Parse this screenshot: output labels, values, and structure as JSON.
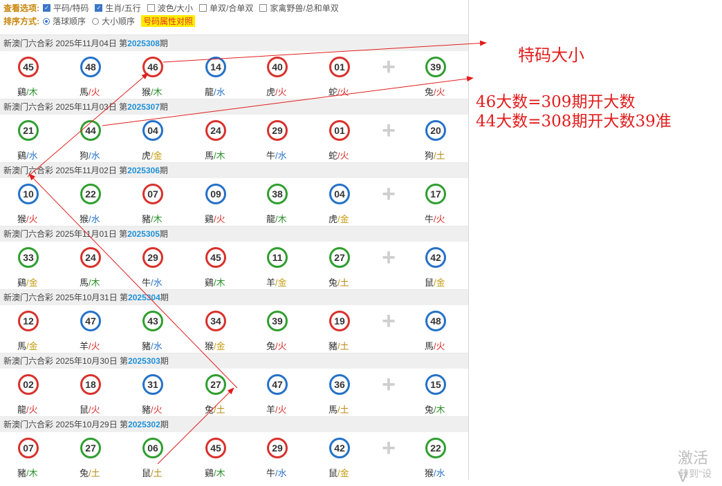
{
  "options": {
    "view_label": "查看选项:",
    "view_items": [
      {
        "label": "平码/特码",
        "checked": true
      },
      {
        "label": "生肖/五行",
        "checked": true
      },
      {
        "label": "波色/大小",
        "checked": false
      },
      {
        "label": "单双/合单双",
        "checked": false
      },
      {
        "label": "家禽野兽/总和单双",
        "checked": false
      }
    ],
    "sort_label": "排序方式:",
    "sort_items": [
      {
        "label": "落球顺序",
        "selected": true
      },
      {
        "label": "大小顺序",
        "selected": false
      }
    ],
    "compare_button": "号码属性对照"
  },
  "draws": [
    {
      "prefix": "新澳门六合彩 2025年11月04日 第",
      "period": "2025308",
      "suffix": "期",
      "balls": [
        {
          "n": "45",
          "c": "red"
        },
        {
          "n": "48",
          "c": "blue"
        },
        {
          "n": "46",
          "c": "red"
        },
        {
          "n": "14",
          "c": "blue"
        },
        {
          "n": "40",
          "c": "red"
        },
        {
          "n": "01",
          "c": "red"
        }
      ],
      "special": {
        "n": "39",
        "c": "green"
      },
      "animals": [
        {
          "a": "鷄",
          "e": "木"
        },
        {
          "a": "馬",
          "e": "火"
        },
        {
          "a": "猴",
          "e": "木"
        },
        {
          "a": "龍",
          "e": "水"
        },
        {
          "a": "虎",
          "e": "火"
        },
        {
          "a": "蛇",
          "e": "火"
        }
      ],
      "special_animal": {
        "a": "兔",
        "e": "火"
      }
    },
    {
      "prefix": "新澳门六合彩 2025年11月03日 第",
      "period": "2025307",
      "suffix": "期",
      "balls": [
        {
          "n": "21",
          "c": "green"
        },
        {
          "n": "44",
          "c": "green"
        },
        {
          "n": "04",
          "c": "blue"
        },
        {
          "n": "24",
          "c": "red"
        },
        {
          "n": "29",
          "c": "red"
        },
        {
          "n": "01",
          "c": "red"
        }
      ],
      "special": {
        "n": "20",
        "c": "blue"
      },
      "animals": [
        {
          "a": "鷄",
          "e": "水"
        },
        {
          "a": "狗",
          "e": "水"
        },
        {
          "a": "虎",
          "e": "金"
        },
        {
          "a": "馬",
          "e": "木"
        },
        {
          "a": "牛",
          "e": "水"
        },
        {
          "a": "蛇",
          "e": "火"
        }
      ],
      "special_animal": {
        "a": "狗",
        "e": "土"
      }
    },
    {
      "prefix": "新澳门六合彩 2025年11月02日 第",
      "period": "2025306",
      "suffix": "期",
      "balls": [
        {
          "n": "10",
          "c": "blue"
        },
        {
          "n": "22",
          "c": "green"
        },
        {
          "n": "07",
          "c": "red"
        },
        {
          "n": "09",
          "c": "blue"
        },
        {
          "n": "38",
          "c": "green"
        },
        {
          "n": "04",
          "c": "blue"
        }
      ],
      "special": {
        "n": "17",
        "c": "green"
      },
      "animals": [
        {
          "a": "猴",
          "e": "火"
        },
        {
          "a": "猴",
          "e": "水"
        },
        {
          "a": "豬",
          "e": "木"
        },
        {
          "a": "鷄",
          "e": "火"
        },
        {
          "a": "龍",
          "e": "木"
        },
        {
          "a": "虎",
          "e": "金"
        }
      ],
      "special_animal": {
        "a": "牛",
        "e": "火"
      }
    },
    {
      "prefix": "新澳门六合彩 2025年11月01日 第",
      "period": "2025305",
      "suffix": "期",
      "balls": [
        {
          "n": "33",
          "c": "green"
        },
        {
          "n": "24",
          "c": "red"
        },
        {
          "n": "29",
          "c": "red"
        },
        {
          "n": "45",
          "c": "red"
        },
        {
          "n": "11",
          "c": "green"
        },
        {
          "n": "27",
          "c": "green"
        }
      ],
      "special": {
        "n": "42",
        "c": "blue"
      },
      "animals": [
        {
          "a": "鷄",
          "e": "金"
        },
        {
          "a": "馬",
          "e": "木"
        },
        {
          "a": "牛",
          "e": "水"
        },
        {
          "a": "鷄",
          "e": "木"
        },
        {
          "a": "羊",
          "e": "金"
        },
        {
          "a": "兔",
          "e": "土"
        }
      ],
      "special_animal": {
        "a": "鼠",
        "e": "金"
      }
    },
    {
      "prefix": "新澳门六合彩 2025年10月31日 第",
      "period": "2025304",
      "suffix": "期",
      "balls": [
        {
          "n": "12",
          "c": "red"
        },
        {
          "n": "47",
          "c": "blue"
        },
        {
          "n": "43",
          "c": "green"
        },
        {
          "n": "34",
          "c": "red"
        },
        {
          "n": "39",
          "c": "green"
        },
        {
          "n": "19",
          "c": "red"
        }
      ],
      "special": {
        "n": "48",
        "c": "blue"
      },
      "animals": [
        {
          "a": "馬",
          "e": "金"
        },
        {
          "a": "羊",
          "e": "火"
        },
        {
          "a": "豬",
          "e": "水"
        },
        {
          "a": "猴",
          "e": "金"
        },
        {
          "a": "兔",
          "e": "火"
        },
        {
          "a": "豬",
          "e": "土"
        }
      ],
      "special_animal": {
        "a": "馬",
        "e": "火"
      }
    },
    {
      "prefix": "新澳门六合彩 2025年10月30日 第",
      "period": "2025303",
      "suffix": "期",
      "balls": [
        {
          "n": "02",
          "c": "red"
        },
        {
          "n": "18",
          "c": "red"
        },
        {
          "n": "31",
          "c": "blue"
        },
        {
          "n": "27",
          "c": "green"
        },
        {
          "n": "47",
          "c": "blue"
        },
        {
          "n": "36",
          "c": "blue"
        }
      ],
      "special": {
        "n": "15",
        "c": "blue"
      },
      "animals": [
        {
          "a": "龍",
          "e": "火"
        },
        {
          "a": "鼠",
          "e": "火"
        },
        {
          "a": "豬",
          "e": "火"
        },
        {
          "a": "兔",
          "e": "土"
        },
        {
          "a": "羊",
          "e": "火"
        },
        {
          "a": "馬",
          "e": "土"
        }
      ],
      "special_animal": {
        "a": "兔",
        "e": "木"
      }
    },
    {
      "prefix": "新澳门六合彩 2025年10月29日 第",
      "period": "2025302",
      "suffix": "期",
      "balls": [
        {
          "n": "07",
          "c": "red"
        },
        {
          "n": "27",
          "c": "green"
        },
        {
          "n": "06",
          "c": "green"
        },
        {
          "n": "45",
          "c": "red"
        },
        {
          "n": "29",
          "c": "red"
        },
        {
          "n": "42",
          "c": "blue"
        }
      ],
      "special": {
        "n": "22",
        "c": "green"
      },
      "animals": [
        {
          "a": "豬",
          "e": "木"
        },
        {
          "a": "兔",
          "e": "土"
        },
        {
          "a": "鼠",
          "e": "土"
        },
        {
          "a": "鷄",
          "e": "木"
        },
        {
          "a": "牛",
          "e": "水"
        },
        {
          "a": "鼠",
          "e": "金"
        }
      ],
      "special_animal": {
        "a": "猴",
        "e": "水"
      }
    }
  ],
  "annotations": {
    "note1": "特码大小",
    "note2_line1": "46大数=309期开大数",
    "note2_line2": "44大数=308期开大数39准"
  },
  "watermark": {
    "line1": "激活 V",
    "line2": "转到\"设"
  }
}
